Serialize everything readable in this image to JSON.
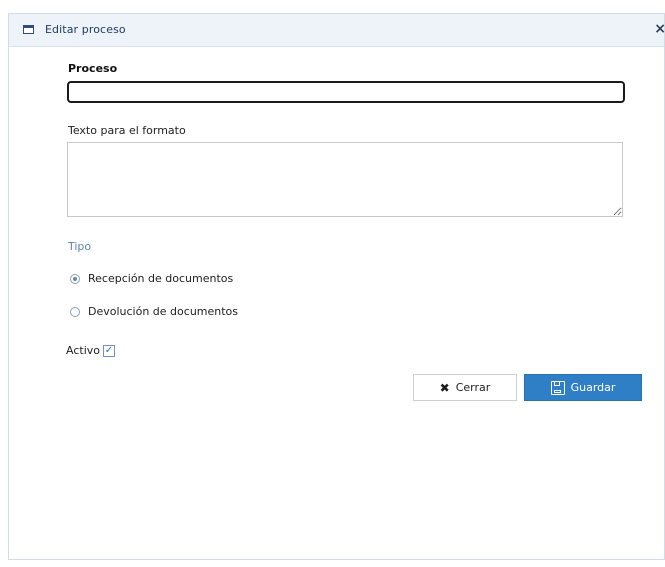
{
  "window": {
    "title": "Editar proceso",
    "close_glyph": "×"
  },
  "form": {
    "proceso_label": "Proceso",
    "proceso_value": "",
    "texto_label": "Texto para el formato",
    "texto_value": "",
    "tipo_label": "Tipo",
    "tipo_options": [
      {
        "label": "Recepción de documentos",
        "selected": true
      },
      {
        "label": "Devolución de documentos",
        "selected": false
      }
    ],
    "activo_label": "Activo",
    "activo_checked": true
  },
  "buttons": {
    "cerrar_label": "Cerrar",
    "cerrar_icon": "close-icon",
    "guardar_label": "Guardar",
    "guardar_icon": "save-icon"
  },
  "colors": {
    "titlebar_bg": "#eef3fa",
    "tipo_label": "#5f86b3",
    "primary_button": "#2f7fc7"
  }
}
